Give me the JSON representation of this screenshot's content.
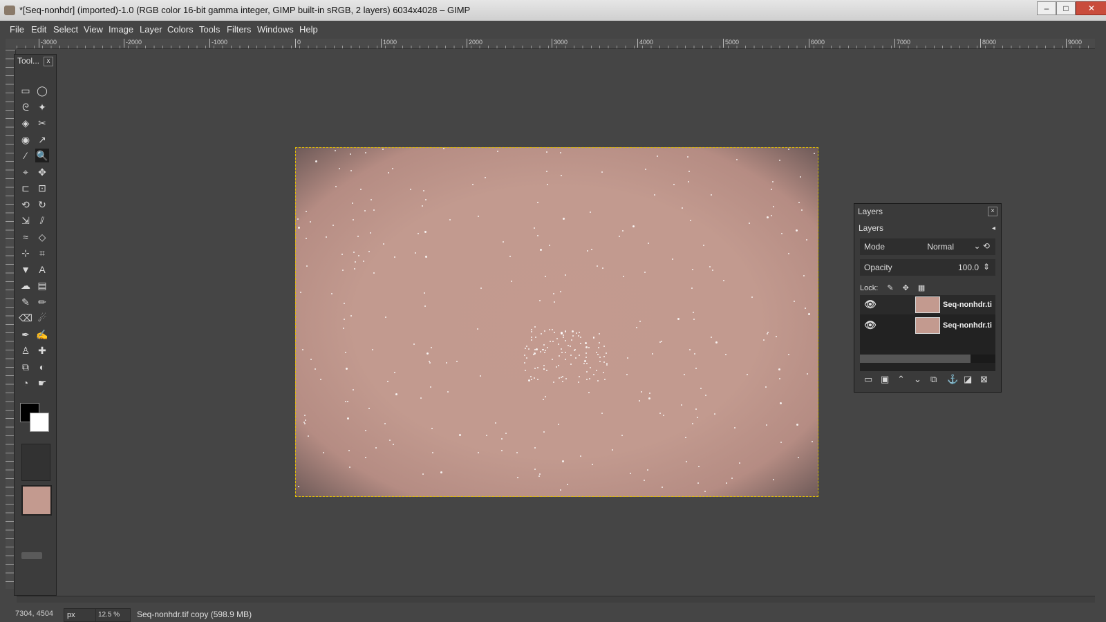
{
  "window": {
    "title": "*[Seq-nonhdr] (imported)-1.0 (RGB color 16-bit gamma integer, GIMP built-in sRGB, 2 layers) 6034x4028 – GIMP",
    "minimize": "–",
    "maximize": "□",
    "close": "✕"
  },
  "menu": [
    "File",
    "Edit",
    "Select",
    "View",
    "Image",
    "Layer",
    "Colors",
    "Tools",
    "Filters",
    "Windows",
    "Help"
  ],
  "ruler": {
    "ticks": [
      "-3000",
      "-2000",
      "-1000",
      "0",
      "1000",
      "2000",
      "3000",
      "4000",
      "5000",
      "6000",
      "7000",
      "8000",
      "9000"
    ]
  },
  "toolbox": {
    "title": "Tool...",
    "close": "x",
    "icons": [
      "rect-select-icon",
      "ellipse-select-icon",
      "free-select-icon",
      "fuzzy-select-icon",
      "select-by-color-icon",
      "scissors-select-icon",
      "foreground-select-icon",
      "paths-icon",
      "color-picker-icon",
      "zoom-icon",
      "measure-icon",
      "move-icon",
      "align-icon",
      "crop-icon",
      "unified-transform-icon",
      "rotate-icon",
      "scale-icon",
      "shear-icon",
      "warp-icon",
      "perspective-icon",
      "handle-transform-icon",
      "cage-icon",
      "bucket-fill-icon",
      "text-icon",
      "smudge-icon",
      "gradient-icon",
      "pencil-icon",
      "paintbrush-icon",
      "eraser-icon",
      "airbrush-icon",
      "ink-icon",
      "mypaint-brush-icon",
      "clone-icon",
      "heal-icon",
      "perspective-clone-icon",
      "blur-icon",
      "dodge-icon",
      "smudge2-icon"
    ]
  },
  "layers_panel": {
    "title": "Layers",
    "tab": "Layers",
    "mode_label": "Mode",
    "mode_value": "Normal",
    "opacity_label": "Opacity",
    "opacity_value": "100.0",
    "lock_label": "Lock:",
    "layers": [
      {
        "name": "Seq-nonhdr.ti"
      },
      {
        "name": "Seq-nonhdr.ti"
      }
    ]
  },
  "status": {
    "coords": "7304, 4504",
    "unit": "px",
    "zoom": "12.5 %",
    "message": "Seq-nonhdr.tif copy (598.9 MB)"
  },
  "colors": {
    "canvas_bg": "#454545",
    "image_tint": "#c39a8f",
    "selection_border": "#e0c000"
  }
}
